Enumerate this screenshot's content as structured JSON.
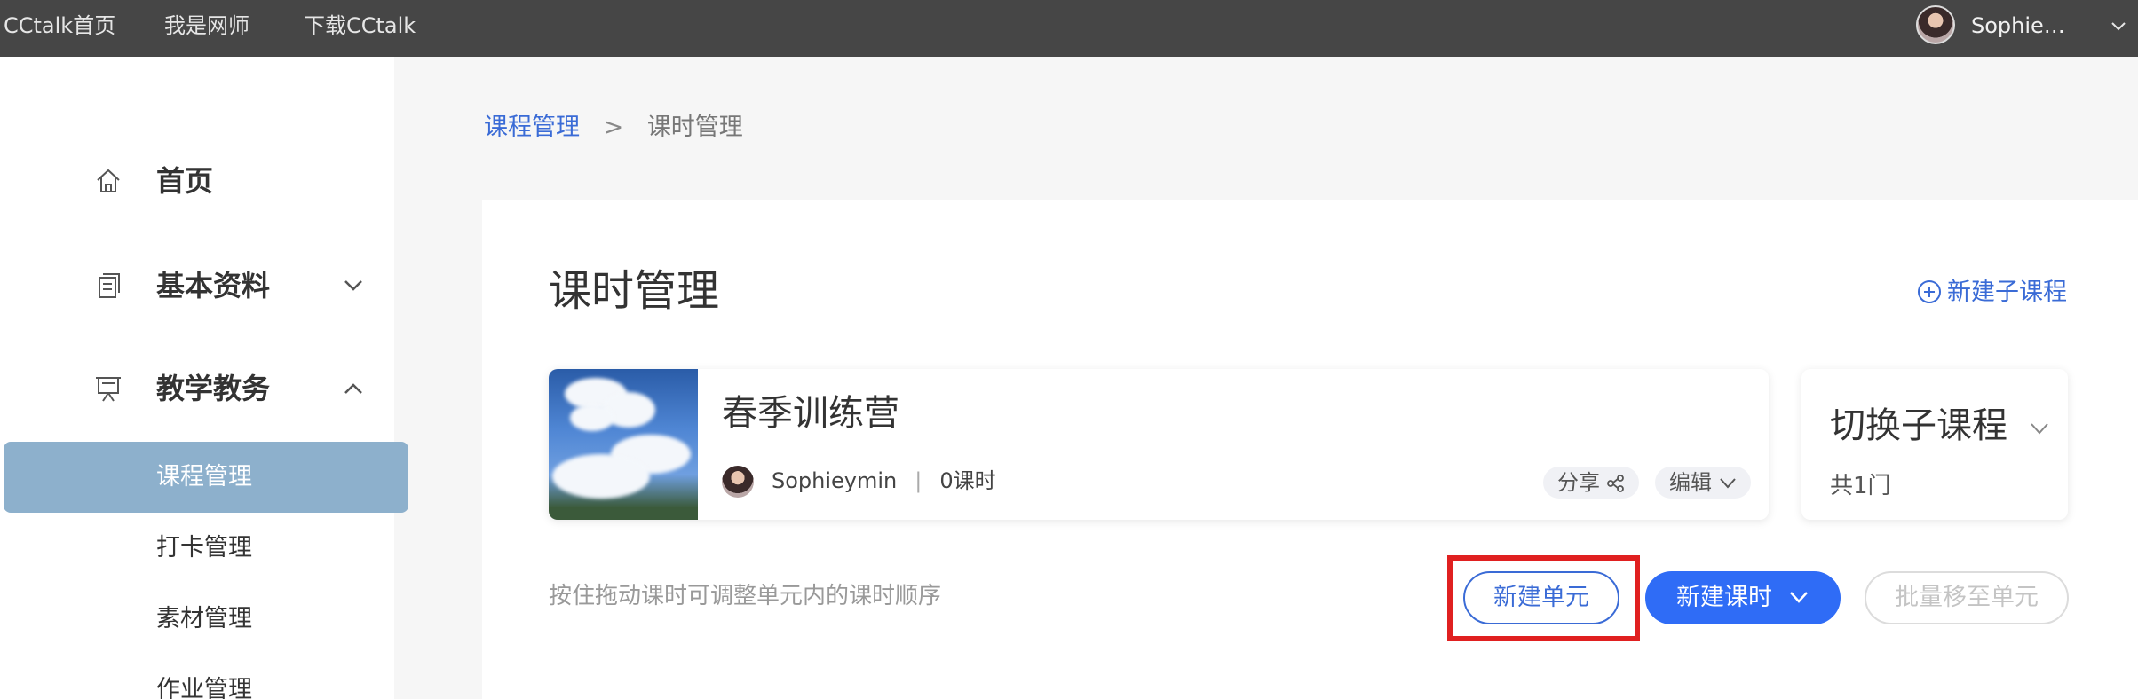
{
  "topbar": {
    "links": [
      "CCtalk首页",
      "我是网师",
      "下载CCtalk"
    ],
    "user_name": "Sophie…"
  },
  "sidebar": {
    "home": "首页",
    "basic_info": "基本资料",
    "teaching": "教学教务",
    "sub_items": [
      "课程管理",
      "打卡管理",
      "素材管理",
      "作业管理"
    ],
    "active_item": "课程管理"
  },
  "breadcrumb": {
    "parent": "课程管理",
    "separator": ">",
    "current": "课时管理"
  },
  "main": {
    "title": "课时管理",
    "new_sub_course": "新建子课程",
    "course": {
      "name": "春季训练营",
      "owner": "Sophieymin",
      "divider": "|",
      "lessons": "0课时",
      "share": "分享",
      "edit": "编辑"
    },
    "switch": {
      "title": "切换子课程",
      "count": "共1门"
    },
    "hint": "按住拖动课时可调整单元内的课时顺序",
    "buttons": {
      "new_unit": "新建单元",
      "new_lesson": "新建课时",
      "batch_move": "批量移至单元"
    }
  },
  "colors": {
    "topbar_bg": "#464646",
    "accent": "#2f6cf6",
    "link": "#3a6bd6",
    "active_item_bg": "#8db0cc",
    "highlight": "#e02020"
  }
}
